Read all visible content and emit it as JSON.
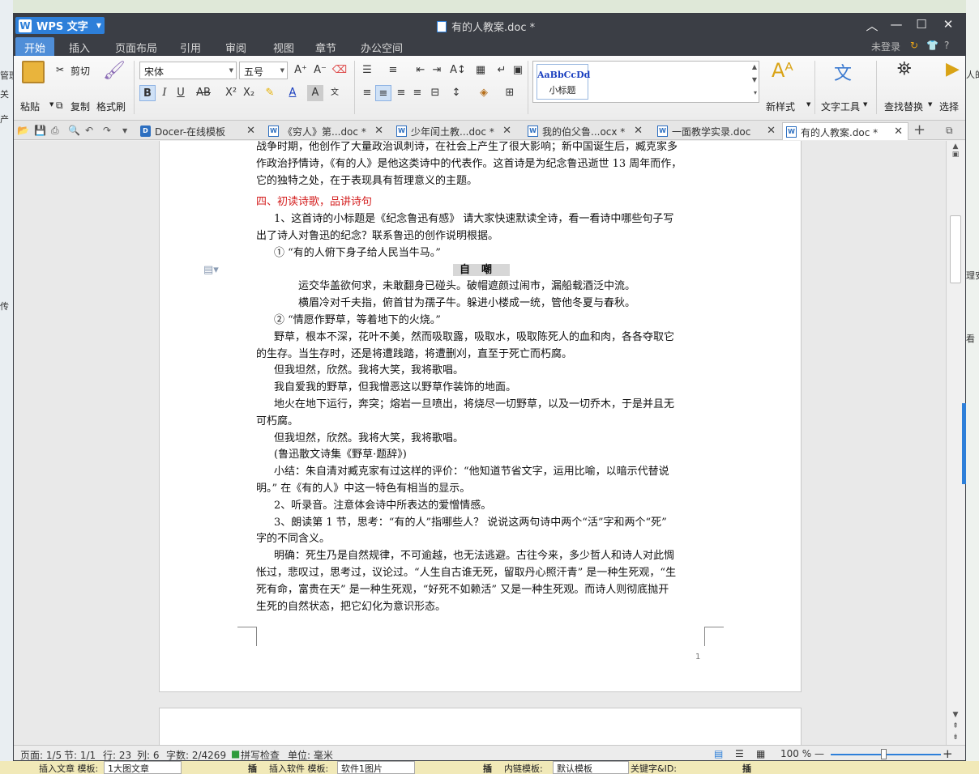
{
  "background": {
    "left_fragments": [
      "管理",
      "关",
      "产",
      "传"
    ],
    "right_fragments": [
      "人的",
      "理安",
      "看"
    ],
    "bottom": {
      "label1": "插入文章 模板:",
      "value1": "1大图文章",
      "btn": "插",
      "label2": "插入软件 模板:",
      "value2": "软件1图片",
      "label3": "内链模板:",
      "value3": "默认模板",
      "label4": "关键字&ID:"
    }
  },
  "titlebar": {
    "app_name": "WPS 文字",
    "doc_title": "有的人教案.doc *"
  },
  "menu": {
    "items": [
      "开始",
      "插入",
      "页面布局",
      "引用",
      "审阅",
      "视图",
      "章节",
      "办公空间"
    ],
    "login": "未登录",
    "help": "?"
  },
  "ribbon": {
    "paste": "粘贴",
    "cut": "剪切",
    "copy": "复制",
    "format_painter": "格式刷",
    "font_name": "宋体",
    "font_size": "五号",
    "style_sample": "AaBbCcDd",
    "style_name": "小标题",
    "new_style": "新样式",
    "text_tools": "文字工具",
    "find_replace": "查找替换",
    "select": "选择"
  },
  "tabs": [
    {
      "label": "Docer-在线模板",
      "active": false
    },
    {
      "label": "《穷人》第...doc *",
      "active": false
    },
    {
      "label": "少年闰土教...doc *",
      "active": false
    },
    {
      "label": "我的伯父鲁...ocx *",
      "active": false
    },
    {
      "label": "一面教学实录.doc",
      "active": false
    },
    {
      "label": "有的人教案.doc *",
      "active": true
    }
  ],
  "document": {
    "lines": {
      "l1": "战争时期，他创作了大量政治讽刺诗，在社会上产生了很大影响；新中国诞生后，臧克家多",
      "l2": "作政治抒情诗，《有的人》是他这类诗中的代表作。这首诗是为纪念鲁迅逝世 13 周年而作，",
      "l3": "它的独特之处，在于表现具有哲理意义的主题。",
      "heading4": "四、初读诗歌，品讲诗句",
      "q1a": "1、这首诗的小标题是《纪念鲁迅有感》 请大家快速默读全诗，看一看诗中哪些句子写",
      "q1b": "出了诗人对鲁迅的纪念？联系鲁迅的创作说明根据。",
      "item1": "① “有的人俯下身子给人民当牛马。”",
      "poem_title": "自嘲",
      "poem1": "运交华盖欲何求，未敢翻身已碰头。破帽遮颜过闹市，漏船载酒泛中流。",
      "poem2": "横眉冷对千夫指，俯首甘为孺子牛。躲进小楼成一统，管他冬夏与春秋。",
      "item2": "② “情愿作野草，等着地下的火烧。”",
      "p1a": "野草，根本不深，花叶不美，然而吸取露，吸取水，吸取陈死人的血和肉，各各夺取它",
      "p1b": "的生存。当生存时，还是将遭践踏，将遭删刈，直至于死亡而朽腐。",
      "p2": "但我坦然，欣然。我将大笑，我将歌唱。",
      "p3": "我自爱我的野草，但我憎恶这以野草作装饰的地面。",
      "p4a": "地火在地下运行，奔突；熔岩一旦喷出，将烧尽一切野草，以及一切乔木，于是并且无",
      "p4b": "可朽腐。",
      "p5": "但我坦然，欣然。我将大笑，我将歌唱。",
      "source": "(鲁迅散文诗集《野草·题辞》)",
      "sum_a": "小结：朱自清对臧克家有过这样的评价：“他知道节省文字，运用比喻，以暗示代替说",
      "sum_b": "明。” 在《有的人》中这一特色有相当的显示。",
      "q2": "2、听录音。注意体会诗中所表达的爱憎情感。",
      "q3a": "3、朗读第 1 节，思考：“有的人”指哪些人？ 说说这两句诗中两个“活”字和两个“死”",
      "q3b": "字的不同含义。",
      "c1": "明确：死生乃是自然规律，不可逾越，也无法逃避。古往今来，多少哲人和诗人对此惆",
      "c2": "怅过，悲叹过，思考过，议论过。“人生自古谁无死，留取丹心照汗青” 是一种生死观，“生",
      "c3": "死有命，富贵在天” 是一种生死观，“好死不如赖活” 又是一种生死观。而诗人则彻底抛开",
      "c4": "生死的自然状态，把它幻化为意识形态。"
    },
    "page_number": "1"
  },
  "status": {
    "page": "页面: 1/5",
    "section": "节: 1/1",
    "row": "行: 23",
    "col": "列: 6",
    "words": "字数: 2/4269",
    "spell": "拼写检查",
    "unit": "单位: 毫米",
    "zoom": "100 %"
  },
  "colors": {
    "accent": "#2d7fd9",
    "titlebar": "#3b3e45",
    "heading_red": "#d42020"
  }
}
